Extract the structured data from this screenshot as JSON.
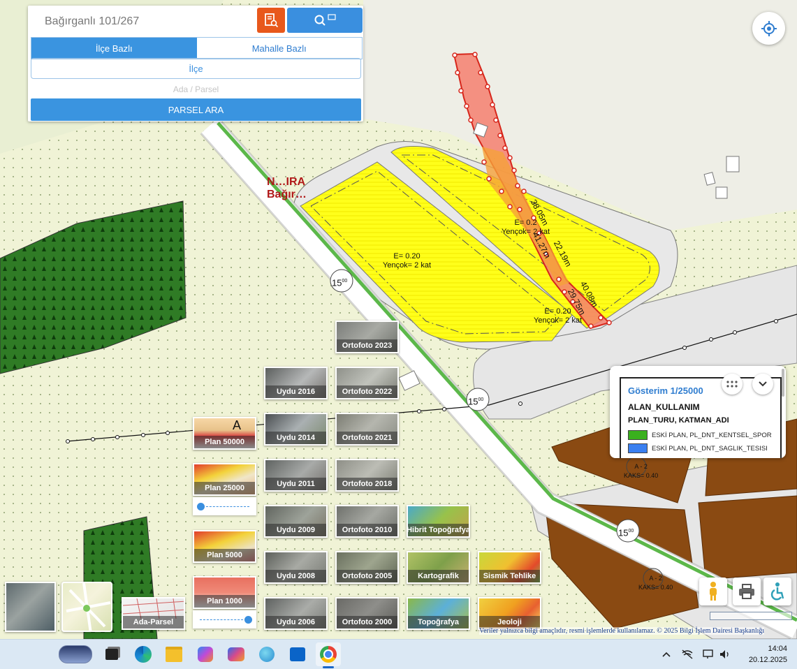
{
  "search": {
    "value": "Bağırganlı 101/267"
  },
  "tabs": [
    "İlçe Bazlı",
    "Mahalle Bazlı"
  ],
  "ilce_select": "İlçe",
  "ada_parsel_placeholder": "Ada / Parsel",
  "parsel_button": "PARSEL ARA",
  "map": {
    "parcel_labels": [
      {
        "e": "E= 0.20",
        "k": "Yençok= 2 kat"
      },
      {
        "e": "E= 0.2",
        "k": "Yençok= 2 kat"
      },
      {
        "e": "E= 0.20",
        "k": "Yençok= 2 kat"
      }
    ],
    "place_label_line1": "N…IRA",
    "place_label_line2": "Bağır…",
    "measurements": [
      "38.05m",
      "41.27m",
      "22.19m",
      "40.08m",
      "29.75m"
    ],
    "road_codes": [
      "15",
      "15",
      "15"
    ],
    "road_code_sup": "00",
    "kaks": [
      "A - 2",
      "KAKS= 0.40",
      "A - 2",
      "KAKS= 0.40"
    ]
  },
  "layer_tiles": {
    "ortofoto": [
      "Ortofoto 2023",
      "Ortofoto 2022",
      "Ortofoto 2021",
      "Ortofoto 2018",
      "Ortofoto 2010",
      "Ortofoto 2005",
      "Ortofoto 2000"
    ],
    "uydu": [
      "Uydu 2016",
      "Uydu 2014",
      "Uydu 2011",
      "Uydu 2009",
      "Uydu 2008",
      "Uydu 2006"
    ],
    "plan": [
      "Plan 50000",
      "Plan 25000",
      "Plan 5000",
      "Plan 1000"
    ],
    "other": [
      "Hibrit Topoğrafya",
      "Kartografik",
      "Sismik Tehlike",
      "Topoğrafya",
      "Jeoloji"
    ],
    "ada_parsel": "Ada-Parsel",
    "plan50000_letter": "A"
  },
  "legend": {
    "scale_title": "Gösterim 1/25000",
    "heading": "ALAN_KULLANIM",
    "subheading": "PLAN_TURU, KATMAN_ADI",
    "items": [
      {
        "label": "ESKİ PLAN, PL_DNT_KENTSEL_SPOR",
        "color": "#3ab01e"
      },
      {
        "label": "ESKİ PLAN, PL_DNT_SAGLIK_TESISI",
        "color": "#3a7ff0"
      }
    ]
  },
  "disclaimer": "Veriler yalnızca bilgi amaçlıdır, resmi işlemlerde kullanılamaz. © 2025 Bilgi İşlem Dairesi Başkanlığı",
  "taskbar": {
    "time": "14:04",
    "date": "20.12.2025"
  },
  "colors": {
    "accent_blue": "#3a94e0",
    "accent_orange": "#e8581c",
    "parcel_yellow": "#ffff1a",
    "forest_green": "#2f7b25",
    "plot_brown": "#8a4a12"
  }
}
